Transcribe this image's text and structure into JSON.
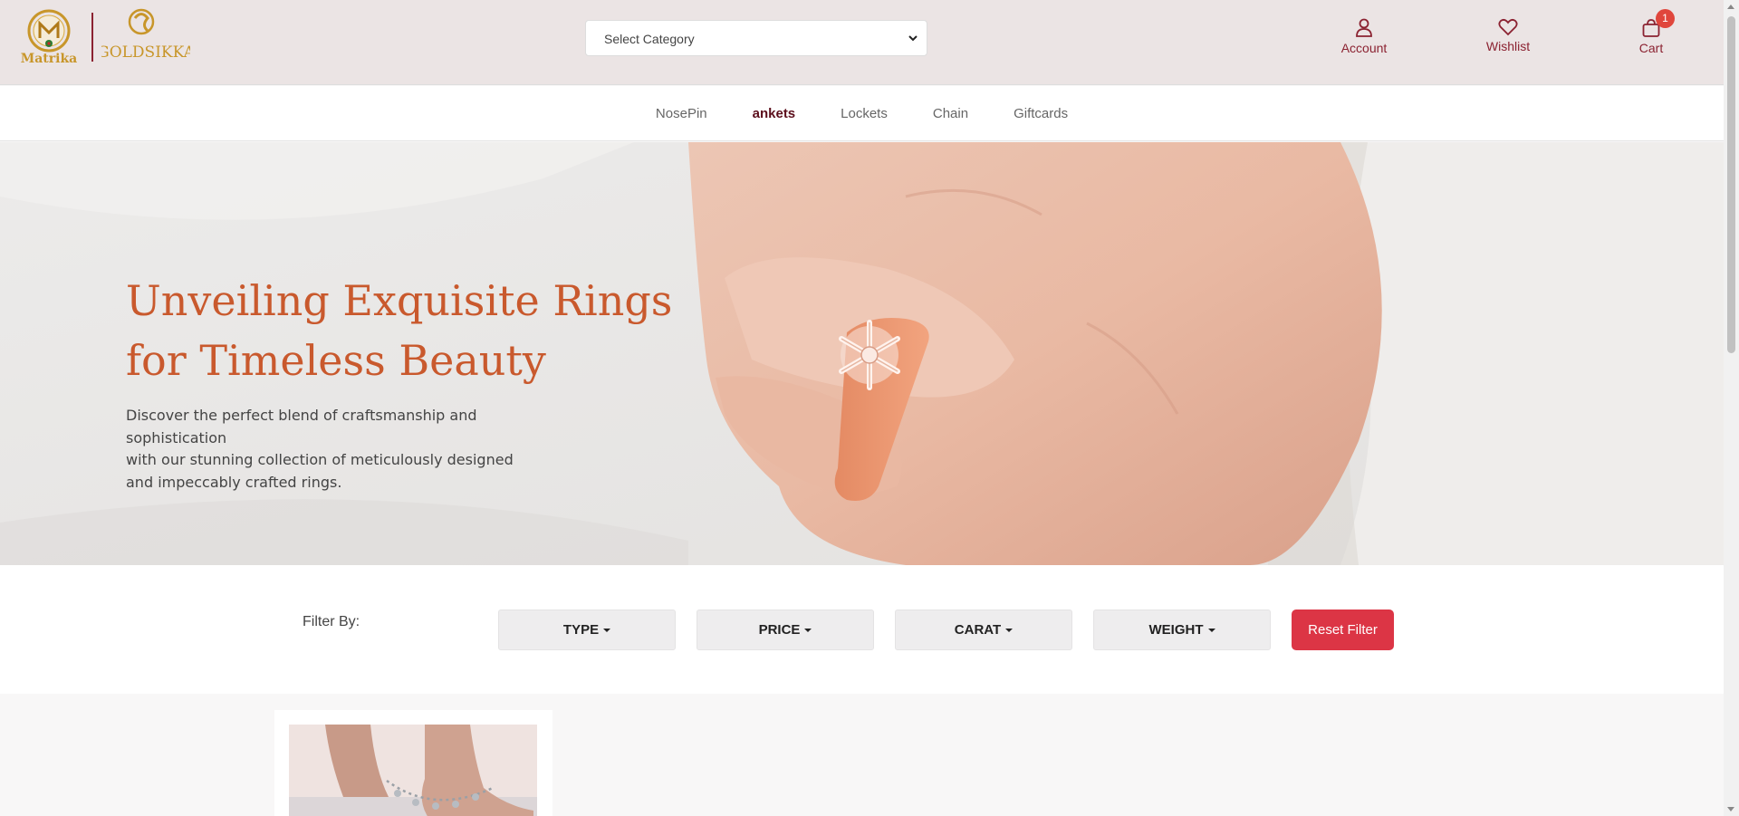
{
  "header": {
    "logos": [
      "Matrika",
      "GOLDSIKKA"
    ],
    "category_select": {
      "value": "Select Category"
    },
    "account_label": "Account",
    "wishlist_label": "Wishlist",
    "cart_label": "Cart",
    "cart_count": "1",
    "brand_color": "#8b2231",
    "icons": [
      "user-icon",
      "heart-icon",
      "shopping-bag-icon"
    ]
  },
  "nav": {
    "items": [
      {
        "label": "NosePin",
        "active": false
      },
      {
        "label": "ankets",
        "active": true
      },
      {
        "label": "Lockets",
        "active": false
      },
      {
        "label": "Chain",
        "active": false
      },
      {
        "label": "Giftcards",
        "active": false
      }
    ]
  },
  "hero": {
    "title_line1": "Unveiling Exquisite Rings",
    "title_line2": "for Timeless Beauty",
    "desc_line1": "Discover the perfect blend of craftsmanship and sophistication",
    "desc_line2": "with our stunning collection of meticulously designed",
    "desc_line3": "and impeccably crafted rings.",
    "title_color": "#c9592d"
  },
  "filters": {
    "label": "Filter By:",
    "buttons": [
      "TYPE",
      "PRICE",
      "CARAT",
      "WEIGHT"
    ],
    "reset_label": "Reset Filter",
    "reset_color": "#dc3545"
  }
}
